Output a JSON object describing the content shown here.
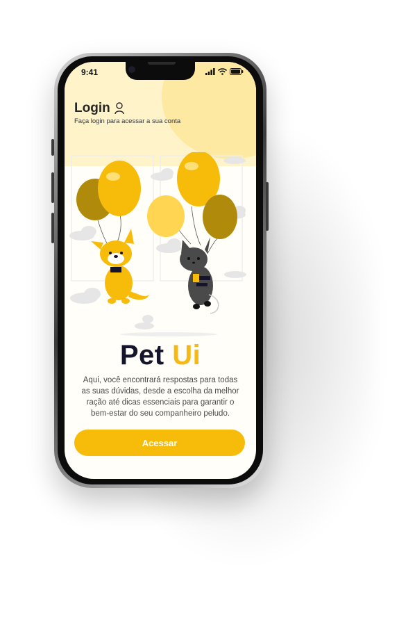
{
  "status_bar": {
    "time": "9:41"
  },
  "header": {
    "title": "Login",
    "subtitle": "Faça login para acessar a sua conta"
  },
  "brand": {
    "word1": "Pet",
    "word2": "Ui"
  },
  "description": "Aqui, você encontrará respostas para todas as suas dúvidas, desde a escolha da melhor ração até dicas essenciais para garantir o bem-estar do seu companheiro peludo.",
  "cta": {
    "label": "Acessar"
  },
  "colors": {
    "accent": "#f7bb0a",
    "brand_dark": "#14142b",
    "header_bg": "#fff4c9"
  },
  "icons": {
    "user": "user-icon",
    "signal": "signal-icon",
    "wifi": "wifi-icon",
    "battery": "battery-icon"
  }
}
